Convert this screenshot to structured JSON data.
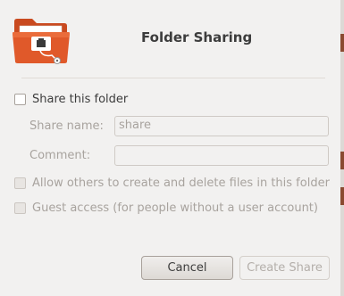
{
  "dialog": {
    "title": "Folder Sharing",
    "icon": "folder-share-icon"
  },
  "share_checkbox": {
    "label": "Share this folder",
    "checked": false
  },
  "share_name": {
    "label": "Share name:",
    "value": "share"
  },
  "comment": {
    "label": "Comment:",
    "value": ""
  },
  "allow_others": {
    "label": "Allow others to create and delete files in this folder",
    "checked": false,
    "enabled": false
  },
  "guest_access": {
    "label": "Guest access (for people without a user account)",
    "checked": false,
    "enabled": false
  },
  "buttons": {
    "cancel": "Cancel",
    "create": "Create Share"
  },
  "colors": {
    "folder_orange": "#e0592a",
    "background": "#f2f1f0"
  }
}
